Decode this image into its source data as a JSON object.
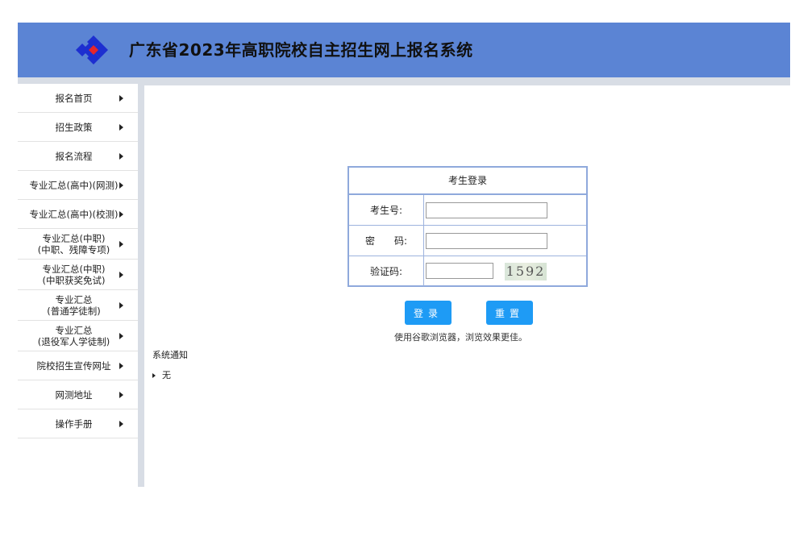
{
  "header": {
    "title": "广东省2023年高职院校自主招生网上报名系统",
    "logo_icon": "diamond-logo-icon",
    "bg_color": "#5b84d4"
  },
  "sidebar": {
    "items": [
      {
        "label": "报名首页"
      },
      {
        "label": "招生政策"
      },
      {
        "label": "报名流程"
      },
      {
        "label": "专业汇总(高中)(网测)"
      },
      {
        "label": "专业汇总(高中)(校测)"
      },
      {
        "label": "专业汇总(中职)\n(中职、残障专项)"
      },
      {
        "label": "专业汇总(中职)\n(中职获奖免试)"
      },
      {
        "label": "专业汇总\n(普通学徒制)"
      },
      {
        "label": "专业汇总\n(退役军人学徒制)"
      },
      {
        "label": "院校招生宣传网址"
      },
      {
        "label": "网测地址"
      },
      {
        "label": "操作手册"
      }
    ]
  },
  "login": {
    "title": "考生登录",
    "id_label": "考生号:",
    "password_label": "密　　码:",
    "captcha_label": "验证码:",
    "id_value": "",
    "password_value": "",
    "captcha_value": "",
    "captcha_text": "1592",
    "login_button": "登录",
    "reset_button": "重置",
    "hint": "使用谷歌浏览器，浏览效果更佳。"
  },
  "notice": {
    "title": "系统通知",
    "items": [
      "无"
    ]
  }
}
